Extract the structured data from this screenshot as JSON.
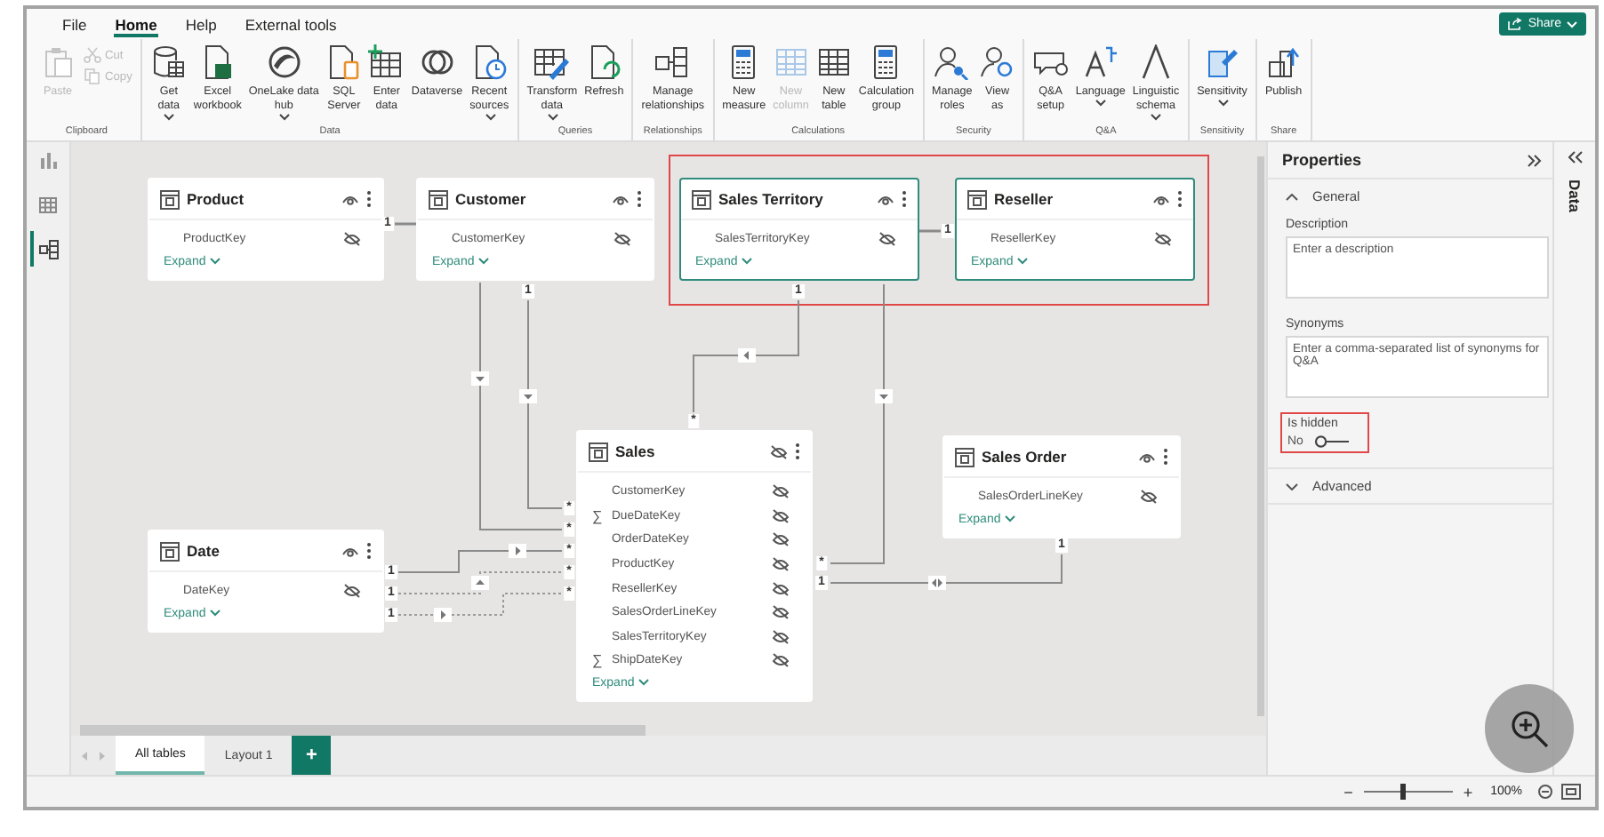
{
  "menu_tabs": [
    {
      "label": "File",
      "selected": false
    },
    {
      "label": "Home",
      "selected": true
    },
    {
      "label": "Help",
      "selected": false
    },
    {
      "label": "External tools",
      "selected": false
    }
  ],
  "share_button": {
    "label": "Share"
  },
  "ribbon_groups": [
    {
      "label": "Clipboard",
      "buttons": [
        {
          "kind": "large",
          "lines": [
            "Paste"
          ],
          "disabled": true,
          "dropdown": false
        },
        {
          "kind": "small",
          "lines": [
            "Cut"
          ],
          "disabled": true,
          "dropdown": false
        },
        {
          "kind": "small",
          "lines": [
            "Copy"
          ],
          "disabled": true,
          "dropdown": false
        }
      ]
    },
    {
      "label": "Data",
      "buttons": [
        {
          "kind": "large",
          "lines": [
            "Get",
            "data"
          ],
          "disabled": false,
          "dropdown": true
        },
        {
          "kind": "large",
          "lines": [
            "Excel",
            "workbook"
          ],
          "disabled": false,
          "dropdown": false
        },
        {
          "kind": "large",
          "lines": [
            "OneLake data",
            "hub"
          ],
          "disabled": false,
          "dropdown": true
        },
        {
          "kind": "large",
          "lines": [
            "SQL",
            "Server"
          ],
          "disabled": false,
          "dropdown": false
        },
        {
          "kind": "large",
          "lines": [
            "Enter",
            "data"
          ],
          "disabled": false,
          "dropdown": false
        },
        {
          "kind": "large",
          "lines": [
            "Dataverse"
          ],
          "disabled": false,
          "dropdown": false
        },
        {
          "kind": "large",
          "lines": [
            "Recent",
            "sources"
          ],
          "disabled": false,
          "dropdown": true
        }
      ]
    },
    {
      "label": "Queries",
      "buttons": [
        {
          "kind": "large",
          "lines": [
            "Transform",
            "data"
          ],
          "disabled": false,
          "dropdown": true
        },
        {
          "kind": "large",
          "lines": [
            "Refresh"
          ],
          "disabled": false,
          "dropdown": false
        }
      ]
    },
    {
      "label": "Relationships",
      "buttons": [
        {
          "kind": "large",
          "lines": [
            "Manage",
            "relationships"
          ],
          "disabled": false,
          "dropdown": false
        }
      ]
    },
    {
      "label": "Calculations",
      "buttons": [
        {
          "kind": "large",
          "lines": [
            "New",
            "measure"
          ],
          "disabled": false,
          "dropdown": false
        },
        {
          "kind": "large",
          "lines": [
            "New",
            "column"
          ],
          "disabled": true,
          "dropdown": false
        },
        {
          "kind": "large",
          "lines": [
            "New",
            "table"
          ],
          "disabled": false,
          "dropdown": false
        },
        {
          "kind": "large",
          "lines": [
            "Calculation",
            "group"
          ],
          "disabled": false,
          "dropdown": false
        }
      ]
    },
    {
      "label": "Security",
      "buttons": [
        {
          "kind": "large",
          "lines": [
            "Manage",
            "roles"
          ],
          "disabled": false,
          "dropdown": false
        },
        {
          "kind": "large",
          "lines": [
            "View",
            "as"
          ],
          "disabled": false,
          "dropdown": false
        }
      ]
    },
    {
      "label": "Q&A",
      "buttons": [
        {
          "kind": "large",
          "lines": [
            "Q&A",
            "setup"
          ],
          "disabled": false,
          "dropdown": false
        },
        {
          "kind": "large",
          "lines": [
            "Language"
          ],
          "disabled": false,
          "dropdown": true
        },
        {
          "kind": "large",
          "lines": [
            "Linguistic",
            "schema"
          ],
          "disabled": false,
          "dropdown": true
        }
      ]
    },
    {
      "label": "Sensitivity",
      "buttons": [
        {
          "kind": "large",
          "lines": [
            "Sensitivity"
          ],
          "disabled": false,
          "dropdown": true
        }
      ]
    },
    {
      "label": "Share",
      "buttons": [
        {
          "kind": "large",
          "lines": [
            "Publish"
          ],
          "disabled": false,
          "dropdown": false
        }
      ]
    }
  ],
  "left_rail": [
    {
      "kind": "report",
      "selected": false
    },
    {
      "kind": "table",
      "selected": false
    },
    {
      "kind": "model",
      "selected": true
    }
  ],
  "diagram": {
    "highlight_selected": true,
    "tables": [
      {
        "name": "Product",
        "header_visible": true,
        "selected": false,
        "expand_label": "Expand",
        "fields": [
          {
            "name": "ProductKey",
            "hidden": true
          }
        ]
      },
      {
        "name": "Customer",
        "header_visible": true,
        "selected": false,
        "expand_label": "Expand",
        "fields": [
          {
            "name": "CustomerKey",
            "hidden": true
          }
        ]
      },
      {
        "name": "Sales Territory",
        "header_visible": true,
        "selected": true,
        "expand_label": "Expand",
        "fields": [
          {
            "name": "SalesTerritoryKey",
            "hidden": true
          }
        ]
      },
      {
        "name": "Reseller",
        "header_visible": true,
        "selected": true,
        "expand_label": "Expand",
        "fields": [
          {
            "name": "ResellerKey",
            "hidden": true
          }
        ]
      },
      {
        "name": "Sales",
        "header_visible": false,
        "selected": false,
        "expand_label": "Expand",
        "fields": [
          {
            "name": "CustomerKey",
            "hidden": true
          },
          {
            "name": "DueDateKey",
            "hidden": true,
            "prefix": "∑"
          },
          {
            "name": "OrderDateKey",
            "hidden": true
          },
          {
            "name": "ProductKey",
            "hidden": true
          },
          {
            "name": "ResellerKey",
            "hidden": true
          },
          {
            "name": "SalesOrderLineKey",
            "hidden": true
          },
          {
            "name": "SalesTerritoryKey",
            "hidden": true
          },
          {
            "name": "ShipDateKey",
            "hidden": true,
            "prefix": "∑"
          }
        ]
      },
      {
        "name": "Sales Order",
        "header_visible": true,
        "selected": false,
        "expand_label": "Expand",
        "fields": [
          {
            "name": "SalesOrderLineKey",
            "hidden": true
          }
        ]
      },
      {
        "name": "Date",
        "header_visible": true,
        "selected": false,
        "expand_label": "Expand",
        "fields": [
          {
            "name": "DateKey",
            "hidden": true
          }
        ]
      }
    ],
    "relationships": [
      {
        "active": true,
        "labels": [
          "1"
        ]
      },
      {
        "active": true,
        "labels": [
          "1",
          "*"
        ]
      },
      {
        "active": true,
        "labels": [
          "*"
        ]
      },
      {
        "active": true,
        "labels": [
          "1",
          "*"
        ]
      },
      {
        "active": false,
        "labels": [
          "1",
          "*"
        ]
      },
      {
        "active": false,
        "labels": [
          "1",
          "*"
        ]
      },
      {
        "active": true,
        "labels": [
          "1",
          "*"
        ]
      },
      {
        "active": true,
        "labels": [
          "*"
        ]
      },
      {
        "active": true,
        "labels": [
          "1"
        ]
      },
      {
        "active": true,
        "labels": [
          "1",
          "1"
        ]
      }
    ]
  },
  "layout_tabs": [
    {
      "label": "All tables",
      "selected": true
    },
    {
      "label": "Layout 1",
      "selected": false
    }
  ],
  "add_layout_button": "+",
  "properties": {
    "title": "Properties",
    "sections": [
      {
        "label": "General",
        "expanded": true
      },
      {
        "label": "Advanced",
        "expanded": false
      }
    ],
    "description": {
      "label": "Description",
      "placeholder": "Enter a description"
    },
    "synonyms": {
      "label": "Synonyms",
      "placeholder": "Enter a comma-separated list of synonyms for Q&A"
    },
    "is_hidden": {
      "label": "Is hidden",
      "value": "No",
      "on": false,
      "highlighted": true
    }
  },
  "data_pane": {
    "title": "Data"
  },
  "status_bar": {
    "zoom_out": "−",
    "zoom_in": "+",
    "zoom": {
      "level": 0.45,
      "reading": "100%"
    }
  }
}
